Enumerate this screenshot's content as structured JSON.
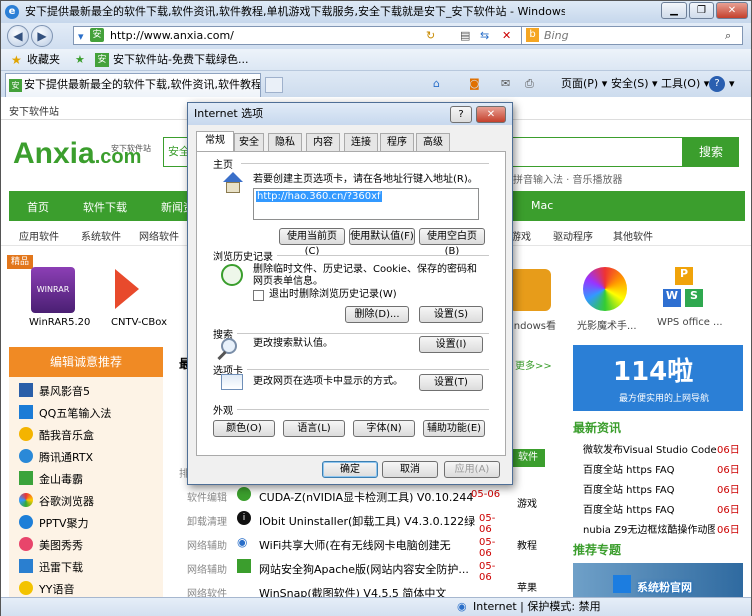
{
  "window": {
    "title": "安下提供最新最全的软件下载,软件资讯,软件教程,单机游戏下载服务,安全下载就是安下_安下软件站 - Windows Internet Explorer"
  },
  "address": {
    "url": "http://www.anxia.com/",
    "search_placeholder": "Bing"
  },
  "favorites": {
    "label": "收藏夹",
    "item1": "安下软件站-免费下载绿色..."
  },
  "tab": {
    "label": "安下提供最新最全的软件下载,软件资讯,软件教程...."
  },
  "commandbar": {
    "page": "页面(P) ▾",
    "safety": "安全(S) ▾",
    "tools": "工具(O) ▾",
    "help": "? ▾"
  },
  "site": {
    "brand_small": "安下软件站",
    "logo_text": "Anxia",
    "logo_com": ".com",
    "logo_sub": "安下软件站",
    "search_button": "搜索",
    "search_prefix": "安全",
    "hot_links": "拼音输入法 · 音乐播放器",
    "nav": [
      "首页",
      "软件下载",
      "新闻资"
    ],
    "nav_right": "Mac",
    "cats": [
      "应用软件",
      "系统软件",
      "网络软件"
    ],
    "cats_right": [
      "游戏",
      "驱动程序",
      "其他软件"
    ],
    "badge": "精品",
    "apps_left": [
      {
        "name": "WinRAR5.20"
      },
      {
        "name": "CNTV-CBox"
      }
    ],
    "apps_right": [
      {
        "name": "indows看"
      },
      {
        "name": "光影魔术手..."
      },
      {
        "name": "WPS office ..."
      }
    ],
    "editor_title": "编辑诚意推荐",
    "editor_list": [
      "暴风影音5",
      "QQ五笔输入法",
      "酷我音乐盒",
      "腾讯通RTX",
      "金山毒霸",
      "谷歌浏览器",
      "PPTV聚力",
      "美图秀秀",
      "迅雷下载",
      "YY语音"
    ],
    "mid_head": "最",
    "more": "更多>>",
    "rows": [
      {
        "cat": "排",
        "name": "",
        "date": ""
      },
      {
        "cat": "软件编辑",
        "name": "CUDA-Z(nVIDIA显卡检测工具) V0.10.244",
        "date": "05-06"
      },
      {
        "cat": "卸载清理",
        "name": "IObit Uninstaller(卸载工具) V4.3.0.122绿",
        "date": "05-06"
      },
      {
        "cat": "网络辅助",
        "name": "WiFi共享大师(在有无线网卡电脑创建无",
        "date": "05-06"
      },
      {
        "cat": "网络辅助",
        "name": "网站安全狗Apache版(网站内容安全防护...",
        "date": "05-06"
      },
      {
        "cat": "网络软件",
        "name": "WinSnap(截图软件) V4.5.5 简体中文",
        "date": "05-06"
      }
    ],
    "side_mid": [
      "软件",
      "游戏",
      "教程",
      "苹果"
    ],
    "banner_num": "114啦",
    "banner_sub": "最方便实用的上网导航",
    "news_title": "最新资讯",
    "news": [
      {
        "t": "微软发布Visual Studio Code",
        "d": "06日"
      },
      {
        "t": "百度全站 https FAQ",
        "d": "06日"
      },
      {
        "t": "百度全站 https FAQ",
        "d": "06日"
      },
      {
        "t": "百度全站 https FAQ",
        "d": "06日"
      },
      {
        "t": "nubia Z9无边框炫酷操作动图图",
        "d": "06日"
      }
    ],
    "topic_title": "推荐专题",
    "watermark": "系统粉官网"
  },
  "status": {
    "zone": "Internet | 保护模式: 禁用"
  },
  "dialog": {
    "title": "Internet 选项",
    "help": "?",
    "close": "✕",
    "tabs": [
      "常规",
      "安全",
      "隐私",
      "内容",
      "连接",
      "程序",
      "高级"
    ],
    "home": {
      "label": "主页",
      "desc": "若要创建主页选项卡，请在各地址行键入地址(R)。",
      "value": "http://hao.360.cn/?360xf",
      "btn_current": "使用当前页(C)",
      "btn_default": "使用默认值(F)",
      "btn_blank": "使用空白页(B)"
    },
    "history": {
      "label": "浏览历史记录",
      "desc": "删除临时文件、历史记录、Cookie、保存的密码和网页表单信息。",
      "checkbox": "退出时删除浏览历史记录(W)",
      "btn_delete": "删除(D)...",
      "btn_settings": "设置(S)"
    },
    "search": {
      "label": "搜索",
      "desc": "更改搜索默认值。",
      "btn": "设置(I)"
    },
    "tabs_sect": {
      "label": "选项卡",
      "desc": "更改网页在选项卡中显示的方式。",
      "btn": "设置(T)"
    },
    "appearance": {
      "label": "外观",
      "colors": "颜色(O)",
      "languages": "语言(L)",
      "fonts": "字体(N)",
      "accessibility": "辅助功能(E)"
    },
    "ok": "确定",
    "cancel": "取消",
    "apply": "应用(A)"
  }
}
